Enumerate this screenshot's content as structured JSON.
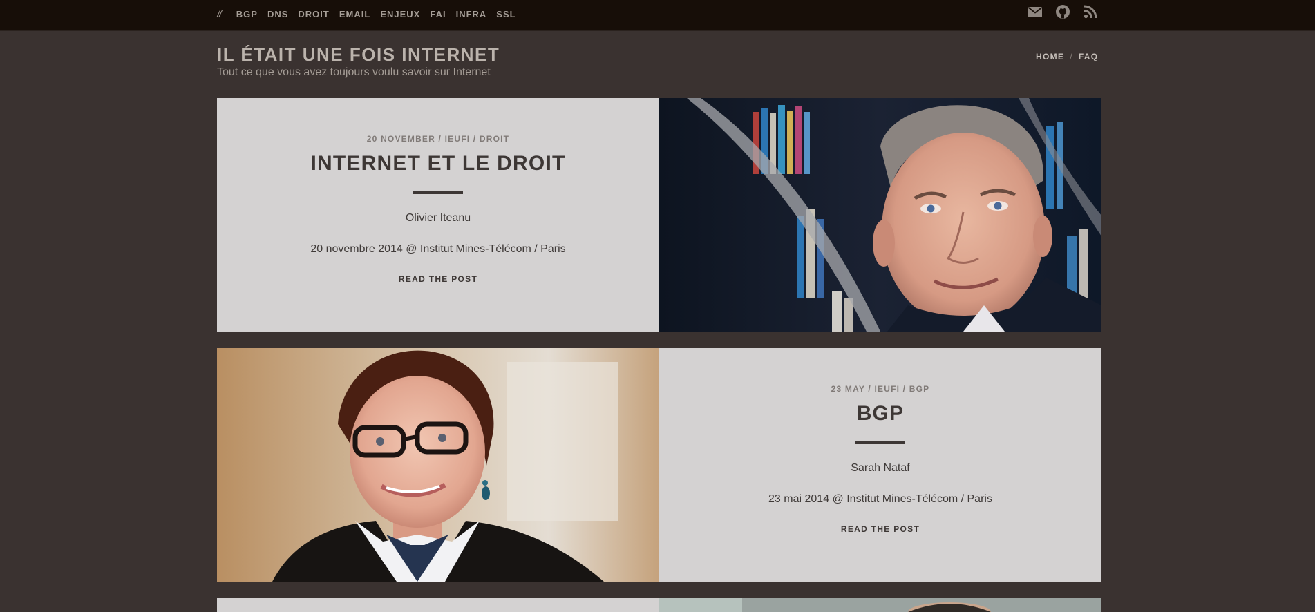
{
  "topbar": {
    "slashes": "//",
    "nav": [
      "BGP",
      "DNS",
      "DROIT",
      "EMAIL",
      "ENJEUX",
      "FAI",
      "INFRA",
      "SSL"
    ],
    "icons": [
      "envelope-icon",
      "github-icon",
      "rss-icon"
    ]
  },
  "header": {
    "title": "IL ÉTAIT UNE FOIS INTERNET",
    "subtitle": "Tout ce que vous avez toujours voulu savoir sur Internet",
    "breadcrumb": {
      "home": "HOME",
      "separator": "/",
      "faq": "FAQ"
    }
  },
  "posts": [
    {
      "meta": "20 NOVEMBER / IEUFI / DROIT",
      "title": "INTERNET ET LE DROIT",
      "author": "Olivier Iteanu",
      "event": "20 novembre 2014 @ Institut Mines-Télécom / Paris",
      "read": "READ THE POST"
    },
    {
      "meta": "23 MAY / IEUFI / BGP",
      "title": "BGP",
      "author": "Sarah Nataf",
      "event": "23 mai 2014 @ Institut Mines-Télécom / Paris",
      "read": "READ THE POST"
    }
  ],
  "colors": {
    "topbar": "#170e08",
    "background": "#3a3230",
    "card": "#d4d2d2",
    "text": "#3d3735"
  }
}
